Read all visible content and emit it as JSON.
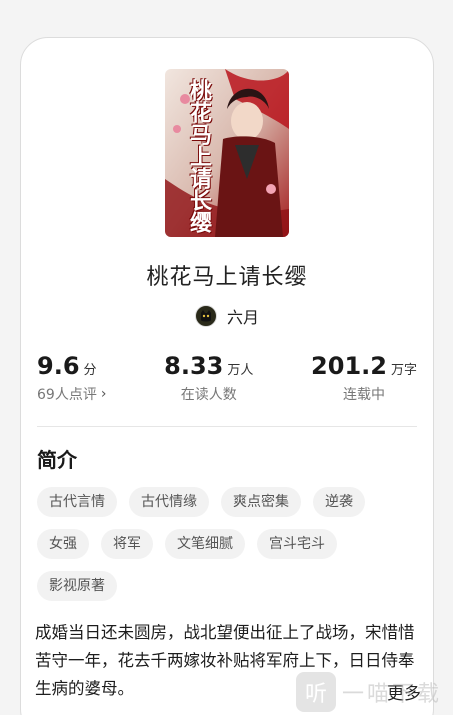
{
  "book": {
    "cover_title": "桃花马上请长缨",
    "title": "桃花马上请长缨",
    "author": "六月"
  },
  "stats": [
    {
      "value": "9.6",
      "unit": "分",
      "label": "69人点评",
      "has_chevron": true
    },
    {
      "value": "8.33",
      "unit": "万人",
      "label": "在读人数"
    },
    {
      "value": "201.2",
      "unit": "万字",
      "label": "连载中"
    }
  ],
  "intro": {
    "heading": "简介",
    "tags": [
      "古代言情",
      "古代情缘",
      "爽点密集",
      "逆袭",
      "女强",
      "将军",
      "文笔细腻",
      "宫斗宅斗",
      "影视原著"
    ],
    "text": "成婚当日还未圆房，战北望便出征上了战场，宋惜惜苦守一年，花去千两嫁妆补贴将军府上下，日日侍奉生病的婆母。",
    "more_label": "更多"
  },
  "watermark": {
    "logo": "听",
    "text": "一喵下载"
  },
  "colors": {
    "background": "#f4f4f4",
    "card": "#ffffff",
    "tag_bg": "#f2f2f2",
    "cover_red": "#b8141c"
  }
}
